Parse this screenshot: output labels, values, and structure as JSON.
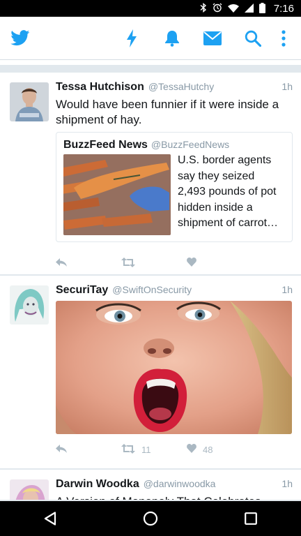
{
  "status_bar": {
    "time": "7:16",
    "icons": [
      "bluetooth-icon",
      "alarm-icon",
      "wifi-icon",
      "signal-icon",
      "battery-icon"
    ]
  },
  "app_bar": {
    "logo": "twitter-bird-icon",
    "actions": [
      "lightning-icon",
      "notifications-bell-icon",
      "messages-envelope-icon",
      "search-icon",
      "overflow-menu-icon"
    ],
    "accent_color": "#1da1f2"
  },
  "tweets": [
    {
      "name": "Tessa Hutchison",
      "handle": "@TessaHutchy",
      "time": "1h",
      "text": "Would have been funnier if it were inside a shipment of hay.",
      "quote": {
        "name": "BuzzFeed News",
        "handle": "@BuzzFeedNews",
        "text": "U.S. border agents say they seized 2,493 pounds of pot hidden inside a shipment of carrot…"
      },
      "retweets": "",
      "likes": ""
    },
    {
      "name": "SecuriTay",
      "handle": "@SwiftOnSecurity",
      "time": "1h",
      "retweets": "11",
      "likes": "48"
    },
    {
      "name": "Darwin Woodka",
      "handle": "@darwinwoodka",
      "time": "1h",
      "text": "A Version of Monopoly That Celebrates"
    }
  ],
  "nav_bar": [
    "back-icon",
    "home-icon",
    "recents-icon"
  ]
}
